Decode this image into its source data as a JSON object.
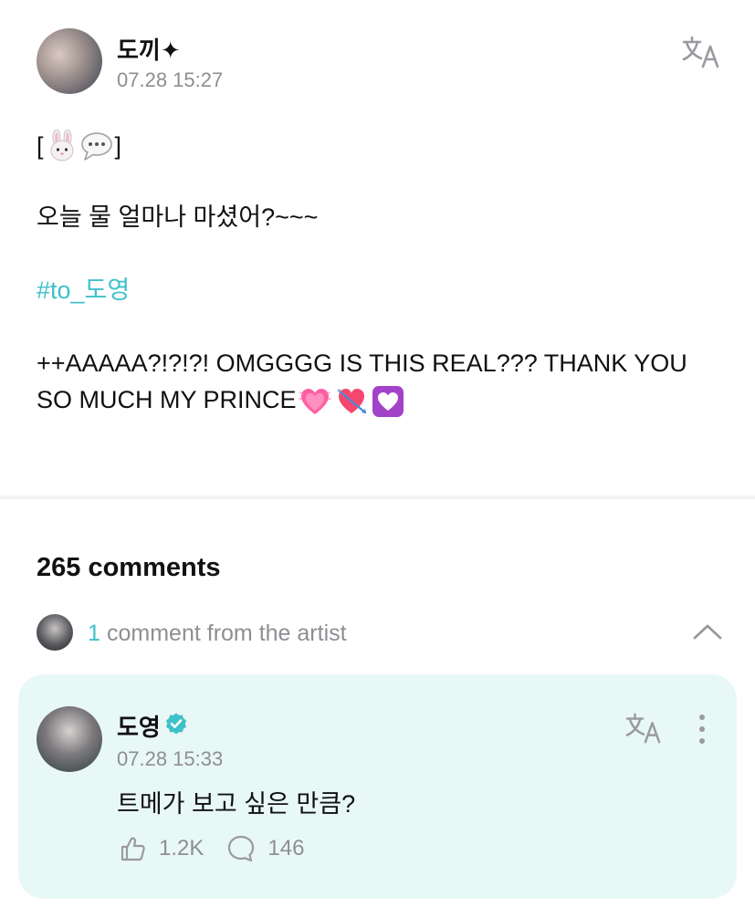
{
  "post": {
    "author": "도끼✦",
    "time": "07.28 15:27",
    "emoji_open": "[",
    "emoji_close": "]",
    "question": "오늘 물 얼마나 마셨어?~~~",
    "hashtag": "#to_도영",
    "message": "++AAAAA?!?!?! OMGGGG IS THIS REAL??? THANK YOU SO MUCH MY PRINCE",
    "icons": {
      "translate": "translate-icon",
      "emojis": [
        "rabbit-emoji",
        "speech-bubble-emoji",
        "sparkling-heart-emoji",
        "heart-with-arrow-emoji",
        "heart-decoration-emoji"
      ]
    }
  },
  "comments": {
    "count_label": "265 comments",
    "artist_count": "1",
    "artist_label": "comment from the artist"
  },
  "artist_comment": {
    "name": "도영",
    "time": "07.28 15:33",
    "text": "트메가 보고 싶은 만큼?",
    "likes": "1.2K",
    "replies": "146"
  },
  "colors": {
    "accent": "#3fc1c9",
    "card_bg": "#e8f8f6",
    "muted": "#8e8e93",
    "divider": "#f2f3f5"
  }
}
